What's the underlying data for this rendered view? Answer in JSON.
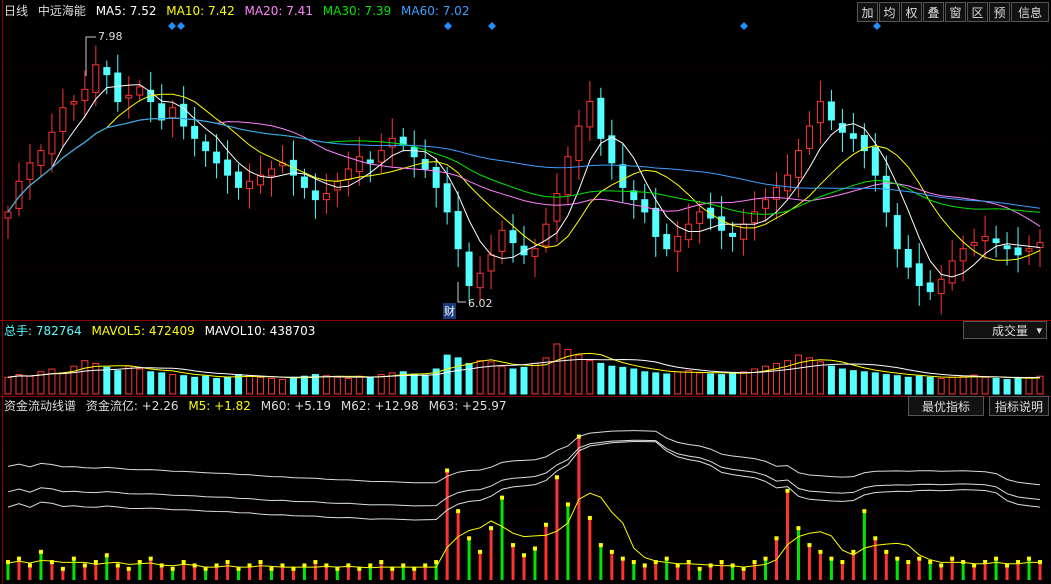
{
  "header": {
    "period": "日线",
    "stock": "中远海能",
    "ma5": "MA5: 7.52",
    "ma10": "MA10: 7.42",
    "ma20": "MA20: 7.41",
    "ma30": "MA30: 7.39",
    "ma60": "MA60: 7.02"
  },
  "toolbar": [
    "加",
    "均",
    "权",
    "叠",
    "窗",
    "区",
    "预",
    "信息"
  ],
  "annotations": {
    "high": "7.98",
    "low": "6.02",
    "cai": "财"
  },
  "volume": {
    "total": "总手: 782764",
    "mavol5": "MAVOL5: 472409",
    "mavol10": "MAVOL10: 438703",
    "dropdown": "成交量",
    "dropdown_arrow": "▾"
  },
  "indicator": {
    "name": "资金流动线谱",
    "flow": "资金流亿: +2.26",
    "m5": "M5: +1.82",
    "m60": "M60: +5.19",
    "m62": "M62: +12.98",
    "m63": "M63: +25.97",
    "best_button": "最优指标",
    "help_button": "指标说明"
  },
  "colors": {
    "up": "#ff3232",
    "down": "#54ffff",
    "ma5": "#ffffff",
    "ma10": "#ffff00",
    "ma20": "#ff80ff",
    "ma30": "#00e600",
    "ma60": "#3ca0ff",
    "marker": "#1e90ff"
  },
  "chart_data": [
    {
      "type": "candlestick",
      "note": "daily close prices (sampled series)",
      "close": [
        6.7,
        6.95,
        7.1,
        7.2,
        7.35,
        7.55,
        7.6,
        7.7,
        7.9,
        7.82,
        7.6,
        7.65,
        7.72,
        7.6,
        7.45,
        7.55,
        7.4,
        7.3,
        7.2,
        7.1,
        7.0,
        6.9,
        6.95,
        7.0,
        7.05,
        7.1,
        7.0,
        6.9,
        6.8,
        6.85,
        6.95,
        7.05,
        7.15,
        7.1,
        7.2,
        7.3,
        7.25,
        7.15,
        7.05,
        6.9,
        6.7,
        6.4,
        6.1,
        6.2,
        6.35,
        6.55,
        6.45,
        6.35,
        6.4,
        6.6,
        6.85,
        7.15,
        7.4,
        7.6,
        7.3,
        7.1,
        6.9,
        6.8,
        6.7,
        6.5,
        6.4,
        6.5,
        6.6,
        6.7,
        6.65,
        6.55,
        6.5,
        6.6,
        6.7,
        6.8,
        6.9,
        7.0,
        7.2,
        7.4,
        7.6,
        7.45,
        7.35,
        7.3,
        7.2,
        7.0,
        6.7,
        6.4,
        6.25,
        6.1,
        6.05,
        6.15,
        6.3,
        6.4,
        6.45,
        6.5,
        6.45,
        6.4,
        6.35,
        6.4,
        6.45
      ],
      "ylim": [
        5.9,
        8.2
      ]
    },
    {
      "type": "bar",
      "name": "volume",
      "values": [
        30,
        35,
        32,
        40,
        45,
        38,
        50,
        60,
        55,
        48,
        42,
        50,
        45,
        40,
        38,
        35,
        33,
        30,
        32,
        28,
        30,
        35,
        33,
        30,
        28,
        26,
        30,
        32,
        35,
        33,
        30,
        28,
        32,
        30,
        35,
        38,
        40,
        36,
        34,
        45,
        70,
        65,
        55,
        60,
        58,
        50,
        45,
        48,
        55,
        65,
        90,
        80,
        70,
        60,
        55,
        50,
        48,
        45,
        40,
        38,
        36,
        40,
        42,
        38,
        36,
        35,
        38,
        40,
        45,
        50,
        55,
        60,
        70,
        65,
        58,
        50,
        45,
        42,
        40,
        38,
        35,
        33,
        30,
        32,
        30,
        28,
        30,
        32,
        34,
        30,
        28,
        26,
        28,
        30,
        32
      ]
    },
    {
      "type": "line",
      "name": "资金流动线谱",
      "values": [
        0.5,
        0.6,
        0.4,
        0.8,
        0.5,
        0.3,
        0.6,
        0.4,
        0.5,
        0.7,
        0.4,
        0.3,
        0.5,
        0.6,
        0.4,
        0.3,
        0.5,
        0.4,
        0.3,
        0.4,
        0.5,
        0.3,
        0.4,
        0.5,
        0.3,
        0.4,
        0.3,
        0.4,
        0.5,
        0.4,
        0.3,
        0.4,
        0.3,
        0.4,
        0.5,
        0.3,
        0.4,
        0.3,
        0.4,
        0.5,
        3.2,
        2.0,
        1.2,
        0.8,
        1.5,
        2.4,
        1.0,
        0.7,
        0.9,
        1.6,
        3.0,
        2.2,
        4.2,
        1.8,
        1.0,
        0.8,
        0.6,
        0.5,
        0.4,
        0.5,
        0.6,
        0.4,
        0.5,
        0.3,
        0.4,
        0.5,
        0.4,
        0.3,
        0.5,
        0.6,
        1.2,
        2.6,
        1.5,
        1.0,
        0.8,
        0.6,
        0.5,
        0.8,
        2.0,
        1.2,
        0.8,
        0.6,
        0.5,
        0.6,
        0.5,
        0.4,
        0.6,
        0.5,
        0.4,
        0.5,
        0.6,
        0.4,
        0.5,
        0.6,
        0.5
      ]
    }
  ]
}
